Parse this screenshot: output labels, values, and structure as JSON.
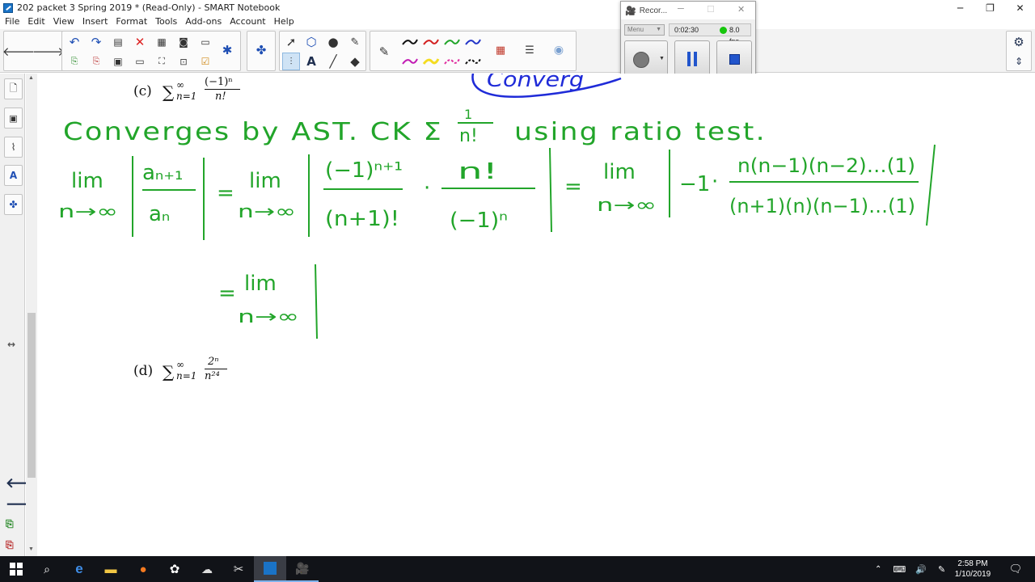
{
  "window": {
    "title": "202 packet 3 Spring 2019 * (Read-Only) - SMART Notebook",
    "minimize_glyph": "─",
    "maximize_glyph": "❐",
    "close_glyph": "✕"
  },
  "menu": [
    "File",
    "Edit",
    "View",
    "Insert",
    "Format",
    "Tools",
    "Add-ons",
    "Account",
    "Help"
  ],
  "recorder": {
    "title": "Recor...",
    "menu_label": "Menu",
    "elapsed": "0:02:30",
    "fps": "8.0 fps",
    "status_color": "#16c60c"
  },
  "page": {
    "problem_c": {
      "label": "(c)",
      "sigma": "∑",
      "upper": "∞",
      "lower": "n=1",
      "numerator": "(−1)ⁿ",
      "denominator": "n!"
    },
    "problem_d": {
      "label": "(d)",
      "sigma": "∑",
      "upper": "∞",
      "lower": "n=1",
      "numerator": "2ⁿ",
      "denominator": "n²⁴"
    },
    "handwriting": {
      "line1": "Converges by AST.  CK  Σ",
      "line1_frac_num": "1",
      "line1_frac_den": "n!",
      "line1_tail": "using  ratio  test.",
      "lim": "lim",
      "n_to_inf": "n→∞",
      "a_next": "aₙ₊₁",
      "a_n": "aₙ",
      "eq": "=",
      "frac1_num": "(−1)ⁿ⁺¹",
      "frac1_den": "(n+1)!",
      "dot": "·",
      "frac2_num": "n!",
      "frac2_den": "(−1)ⁿ",
      "neg_one": "−1",
      "frac3_num": "n(n−1)(n−2)…(1)",
      "frac3_den": "(n+1)(n)(n−1)…(1)",
      "blue_fragment": "Converg"
    },
    "ink_colors": {
      "green": "#22a52a",
      "blue": "#1f2bd8"
    }
  },
  "taskbar": {
    "time": "2:58 PM",
    "date": "1/10/2019"
  }
}
